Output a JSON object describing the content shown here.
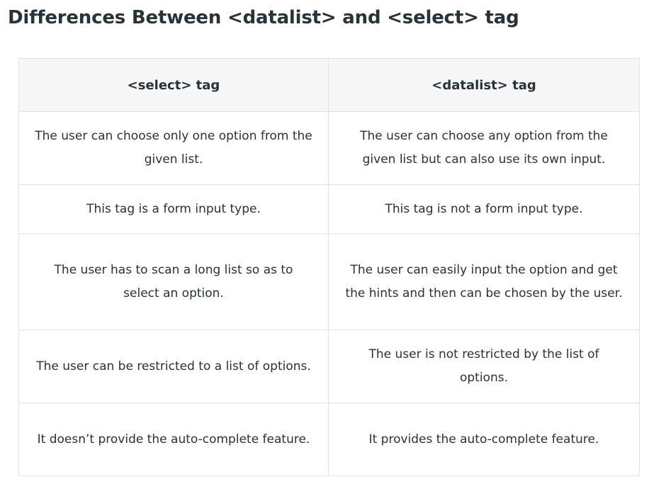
{
  "heading": "Differences Between <datalist> and <select> tag",
  "table": {
    "headers": [
      "<select> tag",
      "<datalist> tag"
    ],
    "rows": [
      [
        "The user can choose only one option from the given list.",
        "The user can choose any option from the given list but can also use its own input."
      ],
      [
        "This tag is a form input type.",
        "This tag is not a form input type."
      ],
      [
        "The user has to scan a long list so as to select an option.",
        "The user can easily input the option and get the hints and then can be chosen by the user."
      ],
      [
        "The user can be restricted to a list of options.",
        "The user is not restricted by the list of options."
      ],
      [
        "It doesn’t provide the auto-complete feature.",
        "It provides the auto-complete feature."
      ]
    ]
  }
}
